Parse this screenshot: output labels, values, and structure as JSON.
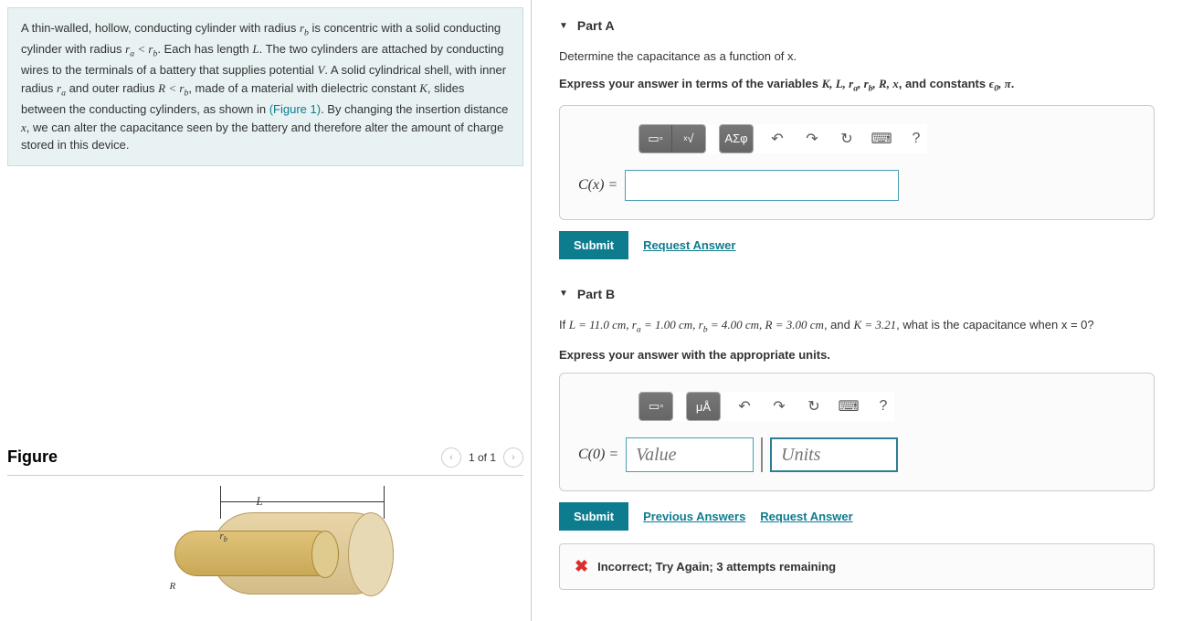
{
  "problem": {
    "text_p1": "A thin-walled, hollow, conducting cylinder with radius ",
    "rb": "r_b",
    "text_p2": " is concentric with a solid conducting cylinder with radius ",
    "ra": "r_a",
    "lt": " < ",
    "text_p3": ". Each has length ",
    "L": "L",
    "text_p4": ". The two cylinders are attached by conducting wires to the terminals of a battery that supplies potential ",
    "V": "V",
    "text_p5": ". A solid cylindrical shell, with inner radius ",
    "text_p6": " and outer radius ",
    "R": "R",
    "text_p7": ", made of a material with dielectric constant ",
    "K": "K",
    "text_p8": ", slides between the conducting cylinders, as shown in ",
    "figref": "(Figure 1)",
    "text_p9": ". By changing the insertion distance ",
    "x": "x",
    "text_p10": ", we can alter the capacitance seen by the battery and therefore alter the amount of charge stored in this device."
  },
  "figure": {
    "title": "Figure",
    "count": "1 of 1",
    "dim_L": "L",
    "label_rb": "r_b",
    "label_R": "R"
  },
  "partA": {
    "title": "Part A",
    "q": "Determine the capacitance as a function of x.",
    "instr_pre": "Express your answer in terms of the variables ",
    "vars": "K, L, r_a, r_b, R, x",
    "instr_mid": ", and constants ",
    "consts": "ϵ₀, π",
    "dot": ".",
    "lhs": "C(x) = ",
    "submit": "Submit",
    "request": "Request Answer"
  },
  "partB": {
    "title": "Part B",
    "q_pre": "If ",
    "q_values": "L = 11.0 cm, r_a = 1.00 cm, r_b = 4.00 cm, R = 3.00 cm",
    "q_mid": ", and ",
    "q_K": "K = 3.21",
    "q_post": ", what is the capacitance when x = 0?",
    "instr": "Express your answer with the appropriate units.",
    "lhs": "C(0) = ",
    "value_ph": "Value",
    "units_ph": "Units",
    "submit": "Submit",
    "previous": "Previous Answers",
    "request": "Request Answer",
    "feedback": "Incorrect; Try Again; 3 attempts remaining"
  },
  "toolbar": {
    "math": "√",
    "greek": "ΑΣφ",
    "units": "μÅ",
    "help": "?"
  }
}
